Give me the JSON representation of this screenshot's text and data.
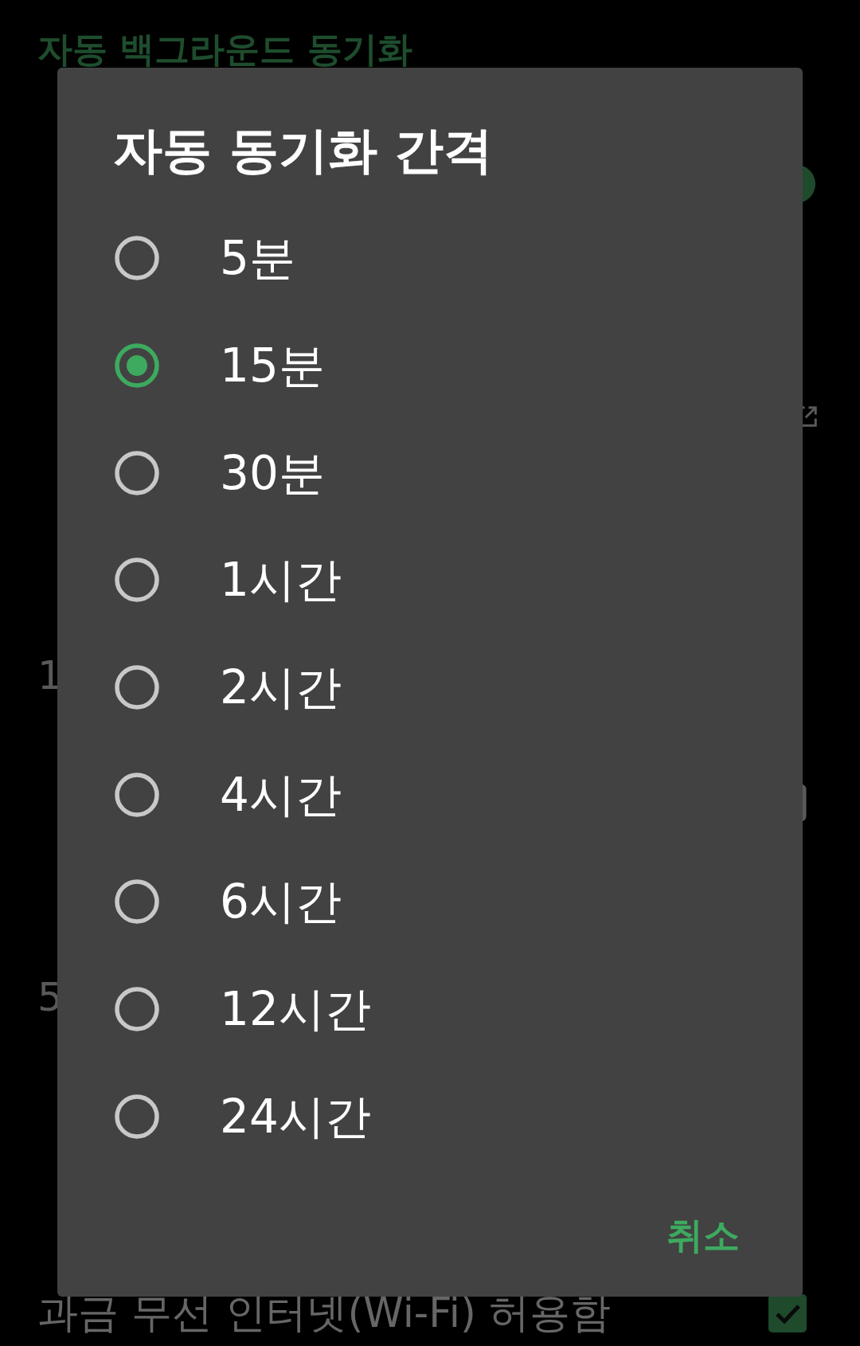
{
  "screen": {
    "header": "자동 백그라운드 동기화",
    "settings": [
      {
        "kind": "switch",
        "on": true
      },
      {
        "kind": "link"
      },
      {
        "kind": "plain",
        "summary": "1"
      },
      {
        "kind": "checkbox",
        "checked": false
      },
      {
        "kind": "plain",
        "summary": "5"
      },
      {
        "kind": "checkbox",
        "title": "과금 무선 인터넷(Wi-Fi) 허용함",
        "checked": true
      }
    ]
  },
  "dialog": {
    "title": "자동 동기화 간격",
    "options": [
      {
        "label": "5분",
        "selected": false
      },
      {
        "label": "15분",
        "selected": true
      },
      {
        "label": "30분",
        "selected": false
      },
      {
        "label": "1시간",
        "selected": false
      },
      {
        "label": "2시간",
        "selected": false
      },
      {
        "label": "4시간",
        "selected": false
      },
      {
        "label": "6시간",
        "selected": false
      },
      {
        "label": "12시간",
        "selected": false
      },
      {
        "label": "24시간",
        "selected": false
      }
    ],
    "buttons": [
      "취소"
    ]
  }
}
